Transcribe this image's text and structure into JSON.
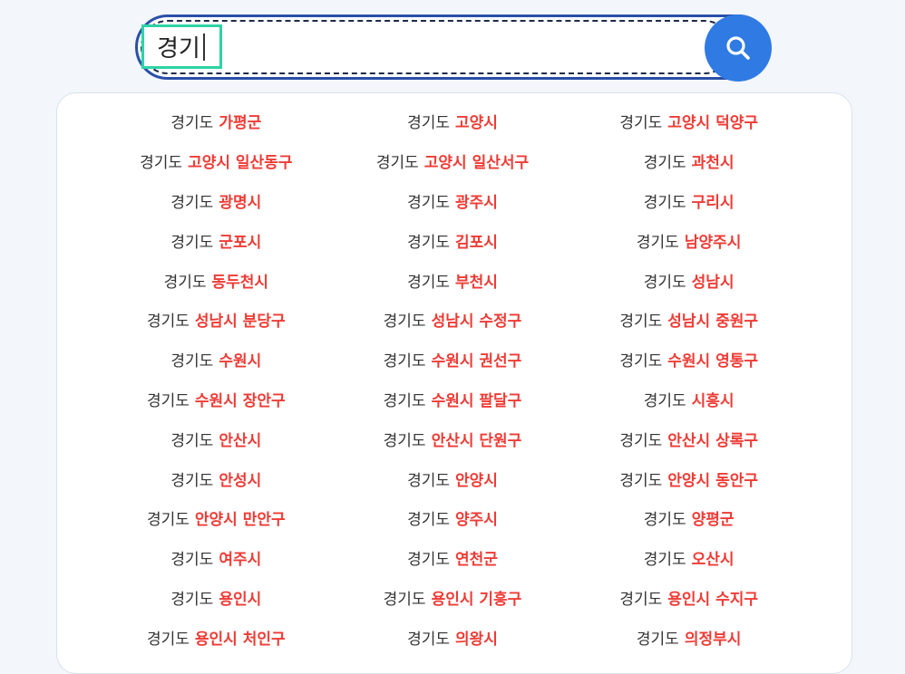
{
  "search": {
    "query": "경기"
  },
  "results": [
    [
      "경기도",
      "가평군"
    ],
    [
      "경기도",
      "고양시"
    ],
    [
      "경기도",
      "고양시 덕양구"
    ],
    [
      "경기도",
      "고양시 일산동구"
    ],
    [
      "경기도",
      "고양시 일산서구"
    ],
    [
      "경기도",
      "과천시"
    ],
    [
      "경기도",
      "광명시"
    ],
    [
      "경기도",
      "광주시"
    ],
    [
      "경기도",
      "구리시"
    ],
    [
      "경기도",
      "군포시"
    ],
    [
      "경기도",
      "김포시"
    ],
    [
      "경기도",
      "남양주시"
    ],
    [
      "경기도",
      "동두천시"
    ],
    [
      "경기도",
      "부천시"
    ],
    [
      "경기도",
      "성남시"
    ],
    [
      "경기도",
      "성남시 분당구"
    ],
    [
      "경기도",
      "성남시 수정구"
    ],
    [
      "경기도",
      "성남시 중원구"
    ],
    [
      "경기도",
      "수원시"
    ],
    [
      "경기도",
      "수원시 권선구"
    ],
    [
      "경기도",
      "수원시 영통구"
    ],
    [
      "경기도",
      "수원시 장안구"
    ],
    [
      "경기도",
      "수원시 팔달구"
    ],
    [
      "경기도",
      "시흥시"
    ],
    [
      "경기도",
      "안산시"
    ],
    [
      "경기도",
      "안산시 단원구"
    ],
    [
      "경기도",
      "안산시 상록구"
    ],
    [
      "경기도",
      "안성시"
    ],
    [
      "경기도",
      "안양시"
    ],
    [
      "경기도",
      "안양시 동안구"
    ],
    [
      "경기도",
      "안양시 만안구"
    ],
    [
      "경기도",
      "양주시"
    ],
    [
      "경기도",
      "양평군"
    ],
    [
      "경기도",
      "여주시"
    ],
    [
      "경기도",
      "연천군"
    ],
    [
      "경기도",
      "오산시"
    ],
    [
      "경기도",
      "용인시"
    ],
    [
      "경기도",
      "용인시 기흥구"
    ],
    [
      "경기도",
      "용인시 수지구"
    ],
    [
      "경기도",
      "용인시 처인구"
    ],
    [
      "경기도",
      "의왕시"
    ],
    [
      "경기도",
      "의정부시"
    ]
  ]
}
